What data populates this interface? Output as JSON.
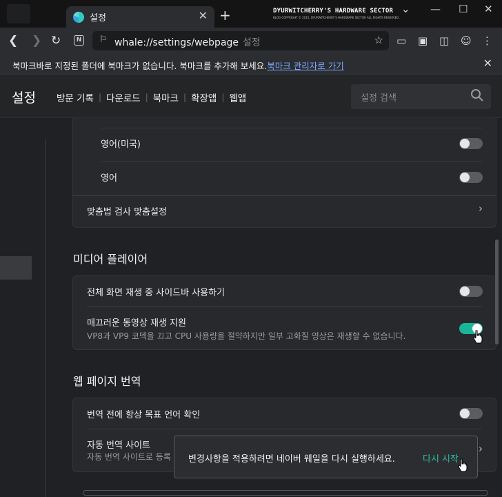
{
  "browser": {
    "tab_title": "설정",
    "tab_close": "✕",
    "new_tab": "+",
    "url": "whale://settings/webpage",
    "url_suffix": "설정",
    "window_controls": {
      "minimize": "—",
      "maximize": "☐",
      "close": "✕",
      "dropdown": "⌄"
    }
  },
  "watermark": {
    "title": "DYURWITCHERRY'S HARDWARE SECTOR",
    "subtitle": "BLOG COPYRIGHT © 2015, DYURWITCHERRY'S HARDWARE SECTOR ALL RIGHTS RESERVED."
  },
  "bookmark_bar": {
    "message": "북마크바로 지정된 폴더에 북마크가 없습니다. 북마크를 추가해 보세요.",
    "link": "북마크 관리자로 가기",
    "close": "✕"
  },
  "settings": {
    "title": "설정",
    "nav": [
      "방문 기록",
      "다운로드",
      "북마크",
      "확장앱",
      "웹앱"
    ],
    "search_placeholder": "설정 검색"
  },
  "spellcheck": {
    "languages": [
      {
        "label": "영어(미국)",
        "enabled": false
      },
      {
        "label": "영어",
        "enabled": false
      }
    ],
    "custom_label": "맞춤법 검사 맞춤설정"
  },
  "media_player": {
    "title": "미디어 플레이어",
    "items": [
      {
        "label": "전체 화면 재생 중 사이드바 사용하기",
        "enabled": false
      },
      {
        "label": "매끄러운 동영상 재생 지원",
        "description": "VP8과 VP9 코덱을 끄고 CPU 사용량을 절약하지만 일부 고화질 영상은 재생할 수 없습니다.",
        "enabled": true
      }
    ]
  },
  "translation": {
    "title": "웹 페이지 번역",
    "always_confirm": {
      "label": "번역 전에 항상 목표 언어 확인",
      "enabled": false
    },
    "auto_sites": {
      "label": "자동 번역 사이트",
      "description": "자동 번역 사이트로 등록"
    }
  },
  "toast": {
    "message": "변경사항을 적용하려면 네이버 웨일을 다시 실행하세요.",
    "action": "다시 시작"
  },
  "colors": {
    "accent": "#19b49a",
    "toast_action": "#2cc1aa",
    "link": "#7aa9ff"
  }
}
